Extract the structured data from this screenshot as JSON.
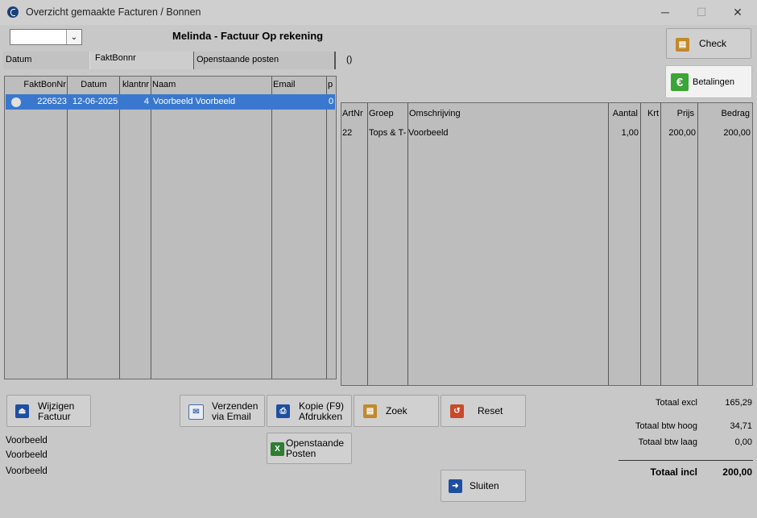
{
  "window": {
    "title": "Overzicht gemaakte Facturen / Bonnen",
    "minimize": "─",
    "maximize": "☐",
    "close": "✕"
  },
  "combo": {
    "value": "",
    "arrow": "⌄"
  },
  "heading": "Melinda  -  Factuur Op rekening",
  "tabs": [
    "Datum",
    "FaktBonnr",
    "Openstaande posten"
  ],
  "paren_label": "()",
  "invoice_table": {
    "columns": [
      "FaktBonNr",
      "Datum",
      "klantnr",
      "Naam",
      "Email",
      "p"
    ],
    "rows": [
      {
        "faktbonnr": "226523",
        "datum": "12-06-2025",
        "klantnr": "4",
        "naam": "Voorbeeld Voorbeeld",
        "email": "",
        "p": "0"
      }
    ]
  },
  "lines_table": {
    "columns": [
      "ArtNr",
      "Groep",
      "Omschrijving",
      "Aantal",
      "Krt",
      "Prijs",
      "Bedrag"
    ],
    "rows": [
      {
        "artnr": "22",
        "groep": "Tops & T-",
        "omschrijving": "Voorbeeld",
        "aantal": "1,00",
        "krt": "",
        "prijs": "200,00",
        "bedrag": "200,00"
      }
    ]
  },
  "buttons": {
    "check": "Check",
    "betalingen": "Betalingen",
    "wijzigen_1": "Wijzigen",
    "wijzigen_2": "Factuur",
    "verzenden_1": "Verzenden",
    "verzenden_2": "via Email",
    "kopie_1": "Kopie (F9)",
    "kopie_2": "Afdrukken",
    "zoek": "Zoek",
    "reset": "Reset",
    "openstaande_1": "Openstaande",
    "openstaande_2": "Posten",
    "sluiten": "Sluiten"
  },
  "info_lines": [
    "Voorbeeld",
    "Voorbeeld",
    "Voorbeeld"
  ],
  "totals": {
    "excl_label": "Totaal excl",
    "excl_value": "165,29",
    "btw_hoog_label": "Totaal btw hoog",
    "btw_hoog_value": "34,71",
    "btw_laag_label": "Totaal btw laag",
    "btw_laag_value": "0,00",
    "incl_label": "Totaal incl",
    "incl_value": "200,00"
  },
  "colors": {
    "selection": "#3a78cf",
    "euro_green": "#3aa635",
    "accent_blue": "#1f4fa0"
  }
}
